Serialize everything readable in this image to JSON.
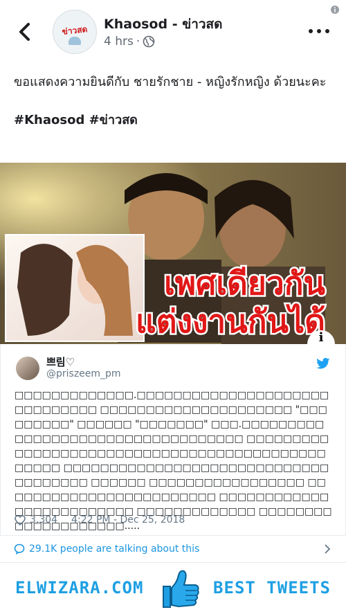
{
  "header": {
    "page_name": "Khaosod - ข่าวสด",
    "time": "4 hrs",
    "separator": "·",
    "avatar_label": "ข่าวสด"
  },
  "post": {
    "text": "ขอแสดงความยินดีกับ ชายรักชาย - หญิงรักหญิง ด้วยนะคะ",
    "hashtags": "#Khaosod #ข่าวสด"
  },
  "image": {
    "headline_line1": "เพศเดียวกัน",
    "headline_line2": "แต่งงานกันได้",
    "icon_glyph": "i"
  },
  "tweet": {
    "name": "쁘림♡",
    "handle": "@priszeem_pm",
    "body": "□□□□□□□□□□□□□.□□□□□□□□□□□□□□□□□□□□□□□□□□□□□□ □□□□□□□□□□□□□□□□□□□□□ \"□□□□□□□□□\" □□□□□□ \"□□□□□□□\" □□□.□□□□□□□□□□□□□□□□□□□□□□□□□□□□□□□□□□ □□□□□□□□□□□□□□□□□□□□□□□□□□□□□□□□□□□□□□□□□□□□□□□□ □□□□□□□□□□□□□□□□□□□□□□□□□□□□□□□□□□□□□ □□□□□□ □□□□□□□□□□□□□□□□□ □□□□□□□□□□□□□□□□□□□□□□□□ □□□□□□□□□□□□□□□□□□□□□□□□□ □□□□□□□□□□□□□ □□□□□□□□□□□□□□□□□□□□.....",
    "likes": "3,304",
    "timestamp": "4:22 PM - Dec 25, 2018"
  },
  "talking": {
    "text": "29.1K people are talking about this"
  },
  "footer": {
    "left": "ELWIZARA.COM",
    "right": "BEST TWEETS"
  },
  "colors": {
    "twitter_blue": "#1da1f2",
    "link_blue": "#1b95e0",
    "brand_blue": "#1e9fe3",
    "headline_red": "#e11717"
  }
}
